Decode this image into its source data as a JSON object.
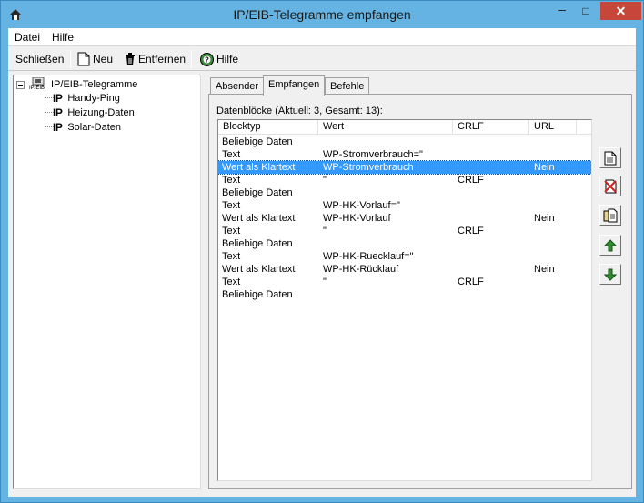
{
  "window": {
    "title": "IP/EIB-Telegramme empfangen",
    "close_glyph": "✕",
    "min_glyph": "–",
    "max_glyph": "□"
  },
  "menu": {
    "items": [
      {
        "label": "Datei"
      },
      {
        "label": "Hilfe"
      }
    ]
  },
  "toolbar": {
    "close_label": "Schließen",
    "new_label": "Neu",
    "remove_label": "Entfernen",
    "help_label": "Hilfe"
  },
  "tree": {
    "root": {
      "label": "IP/EIB-Telegramme",
      "icon_caption": "IP/EIB"
    },
    "ip_mark": "IP",
    "items": [
      {
        "label": "Handy-Ping"
      },
      {
        "label": "Heizung-Daten"
      },
      {
        "label": "Solar-Daten"
      }
    ]
  },
  "tabs": [
    {
      "label": "Absender"
    },
    {
      "label": "Empfangen",
      "active": true
    },
    {
      "label": "Befehle"
    }
  ],
  "blocks": {
    "label": "Datenblöcke (Aktuell: 3, Gesamt: 13):",
    "columns": [
      "Blocktyp",
      "Wert",
      "CRLF",
      "URL"
    ],
    "selected_index": 2,
    "rows": [
      [
        "Beliebige Daten",
        "",
        "",
        ""
      ],
      [
        "Text",
        "WP-Stromverbrauch=\"",
        "",
        ""
      ],
      [
        "Wert als Klartext",
        "WP-Stromverbrauch",
        "",
        "Nein"
      ],
      [
        "Text",
        "\"",
        "CRLF",
        ""
      ],
      [
        "Beliebige Daten",
        "",
        "",
        ""
      ],
      [
        "Text",
        "WP-HK-Vorlauf=\"",
        "",
        ""
      ],
      [
        "Wert als Klartext",
        "WP-HK-Vorlauf",
        "",
        "Nein"
      ],
      [
        "Text",
        "\"",
        "CRLF",
        ""
      ],
      [
        "Beliebige Daten",
        "",
        "",
        ""
      ],
      [
        "Text",
        "WP-HK-Ruecklauf=\"",
        "",
        ""
      ],
      [
        "Wert als Klartext",
        "WP-HK-Rücklauf",
        "",
        "Nein"
      ],
      [
        "Text",
        "\"",
        "CRLF",
        ""
      ],
      [
        "Beliebige Daten",
        "",
        "",
        ""
      ]
    ]
  },
  "side_buttons": [
    {
      "icon": "new-document-icon"
    },
    {
      "icon": "delete-icon"
    },
    {
      "icon": "copy-icon"
    },
    {
      "icon": "arrow-up-icon"
    },
    {
      "icon": "arrow-down-icon"
    }
  ],
  "colors": {
    "titlebar": "#65b3e3",
    "close": "#c7463a",
    "selection": "#3399ff"
  }
}
